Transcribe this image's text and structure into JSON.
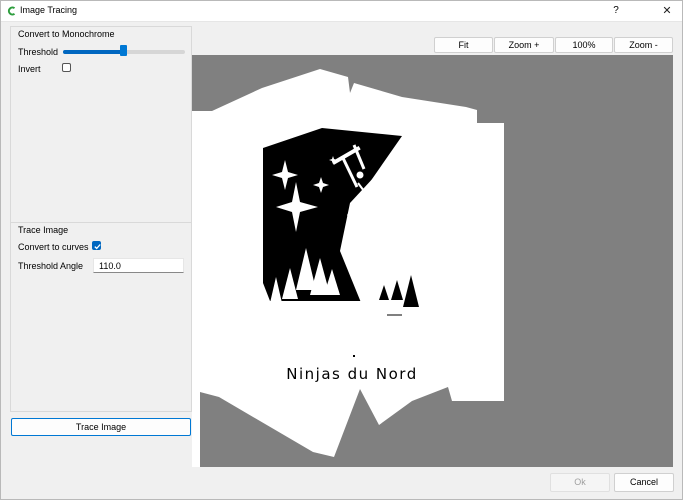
{
  "window": {
    "title": "Image Tracing",
    "help_label": "?",
    "close_label": "✕"
  },
  "mono": {
    "title": "Convert to Monochrome",
    "threshold_label": "Threshold",
    "threshold_value": 0.5,
    "invert_label": "Invert",
    "invert_checked": false
  },
  "trace": {
    "title": "Trace Image",
    "curves_label": "Convert to curves",
    "curves_checked": true,
    "angle_label": "Threshold Angle",
    "angle_value": "110.0",
    "button_label": "Trace Image"
  },
  "toolbar": {
    "fit": "Fit",
    "zoom_in": "Zoom +",
    "zoom_100": "100%",
    "zoom_out": "Zoom -"
  },
  "preview": {
    "logo_text": "Ninjas du Nord"
  },
  "footer": {
    "ok": "Ok",
    "cancel": "Cancel"
  },
  "colors": {
    "accent": "#0067c0",
    "preview_bg": "#808080"
  }
}
